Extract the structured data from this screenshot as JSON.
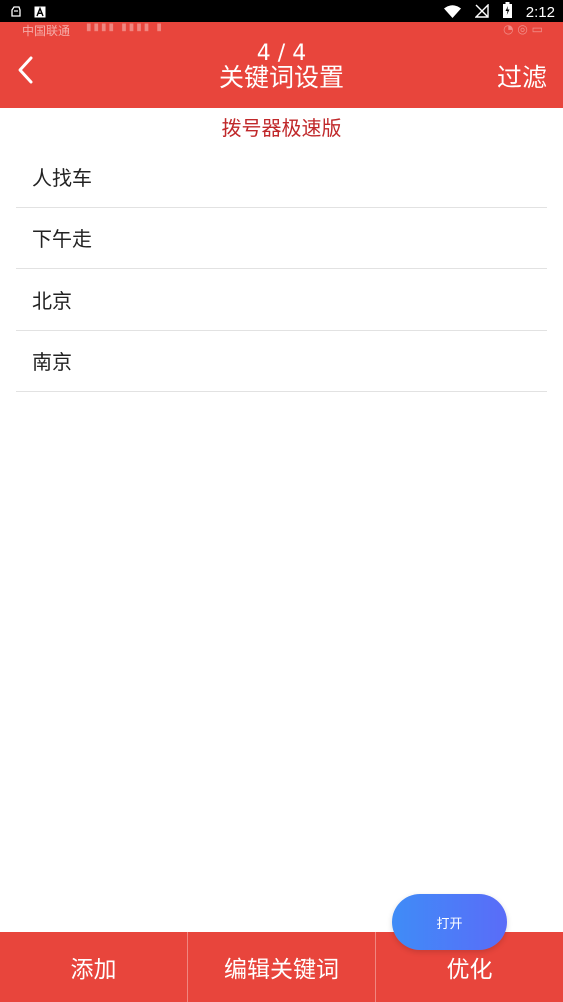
{
  "status_bar": {
    "time": "2:12",
    "left_icons": [
      "notification-icon",
      "a-badge-icon"
    ],
    "right_icons": [
      "wifi-icon",
      "no-signal-icon",
      "battery-charging-icon"
    ]
  },
  "header": {
    "ghost_carrier": "中国联通",
    "page_count": "4 / 4",
    "title": "关键词设置",
    "filter_label": "过滤",
    "color": "#e8453c"
  },
  "app_name": "拨号器极速版",
  "keywords": [
    {
      "label": "人找车"
    },
    {
      "label": "下午走"
    },
    {
      "label": "北京"
    },
    {
      "label": "南京"
    }
  ],
  "float_button": {
    "label": "打开"
  },
  "bottom_bar": {
    "add_label": "添加",
    "edit_label": "编辑关键词",
    "optimize_label": "优化"
  }
}
